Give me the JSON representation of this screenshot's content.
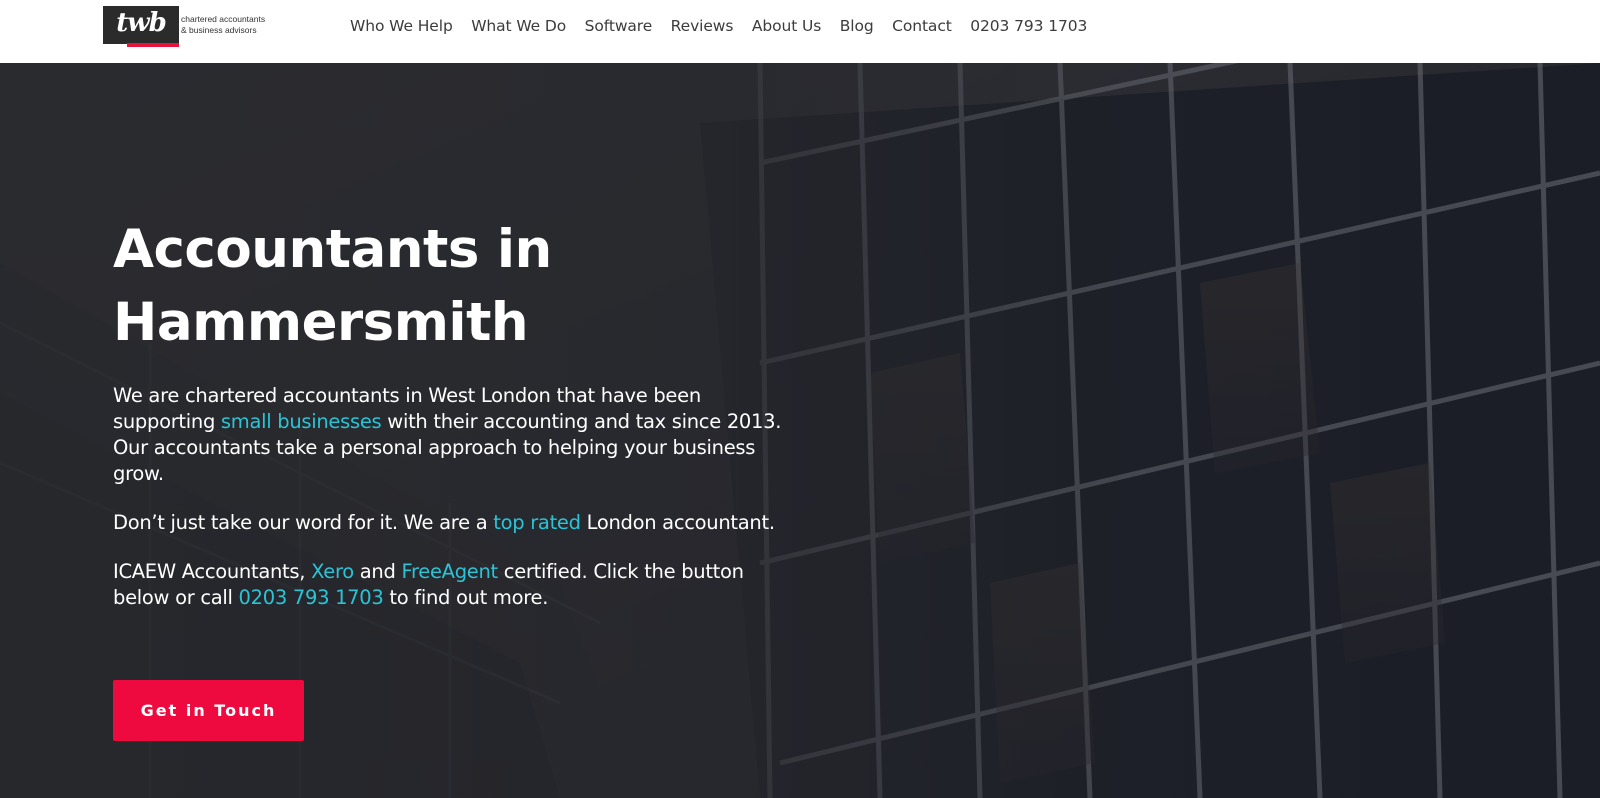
{
  "brand": {
    "logo_word": "twb",
    "tagline_line1": "chartered accountants",
    "tagline_line2": "& business advisors",
    "accent": "#ee0a3f",
    "link_color": "#2bc3d6"
  },
  "nav": {
    "items": [
      {
        "label": "Who We Help"
      },
      {
        "label": "What We Do"
      },
      {
        "label": "Software"
      },
      {
        "label": "Reviews"
      },
      {
        "label": "About Us"
      },
      {
        "label": "Blog"
      },
      {
        "label": "Contact"
      },
      {
        "label": "0203 793 1703"
      }
    ]
  },
  "hero": {
    "title_line1": "Accountants in",
    "title_line2": "Hammersmith",
    "p1": {
      "a": "We are chartered accountants in West London that have been supporting ",
      "link": "small businesses",
      "b": " with their accounting and tax since 2013. Our accountants take a personal approach to helping your business grow."
    },
    "p2": {
      "a": "Don’t just take our word for it. We are a ",
      "link": "top rated",
      "b": " London accountant."
    },
    "p3": {
      "a": "ICAEW Accountants, ",
      "link1": "Xero",
      "b": " and ",
      "link2": "FreeAgent",
      "c": " certified. Click the button below or call ",
      "link3": "0203 793 1703",
      "d": " to find out more."
    },
    "cta_label": "Get in Touch",
    "background_image": "office-building-glass-facade"
  }
}
